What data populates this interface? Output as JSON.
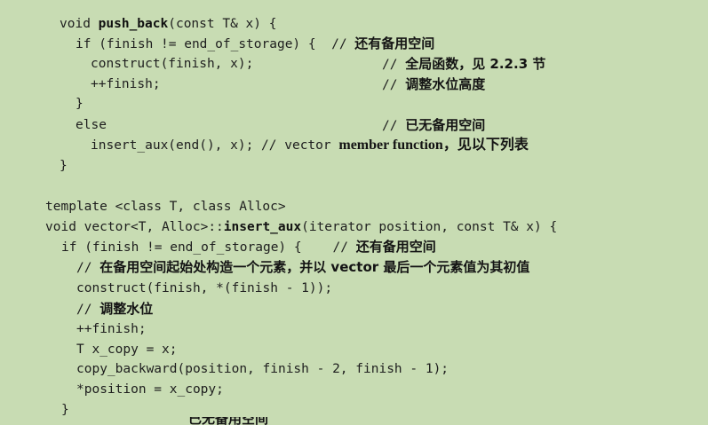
{
  "code": {
    "push_back_sig": {
      "pre": "void ",
      "name": "push_back",
      "post": "(const T& x) {"
    },
    "if1": {
      "code": "if (finish != end_of_storage) {  ",
      "slashes": "// ",
      "comment": "还有备用空间"
    },
    "construct1": {
      "code": "construct(finish, x);",
      "slashes": "// ",
      "comment": "全局函数，见 2.2.3 节"
    },
    "incr1": {
      "code": "++finish;",
      "slashes": "// ",
      "comment": "调整水位高度"
    },
    "close1": "}",
    "else1": {
      "code": "else",
      "slashes": "// ",
      "comment": "已无备用空间"
    },
    "insert_call": {
      "code": "insert_aux(end(), x); // vector ",
      "comment": "member function，见以下列表"
    },
    "close2": "}",
    "template_line": "template <class T, class Alloc>",
    "insert_aux_sig": {
      "pre": "void vector<T, Alloc>::",
      "name": "insert_aux",
      "post": "(iterator position, const T& x) {"
    },
    "if2": {
      "code": "if (finish != end_of_storage) {    ",
      "slashes": "// ",
      "comment": "还有备用空间"
    },
    "comment_construct": {
      "slashes": "// ",
      "comment": "在备用空间起始处构造一个元素，并以 vector 最后一个元素值为其初值"
    },
    "construct2": "construct(finish, *(finish - 1));",
    "comment_adjust": {
      "slashes": "// ",
      "comment": "调整水位"
    },
    "incr2": "++finish;",
    "xcopy": "T x_copy = x;",
    "copy_backward": "copy_backward(position, finish - 2, finish - 1);",
    "assign": "*position = x_copy;",
    "close3": "}",
    "cut_line": "已无备用空间"
  }
}
